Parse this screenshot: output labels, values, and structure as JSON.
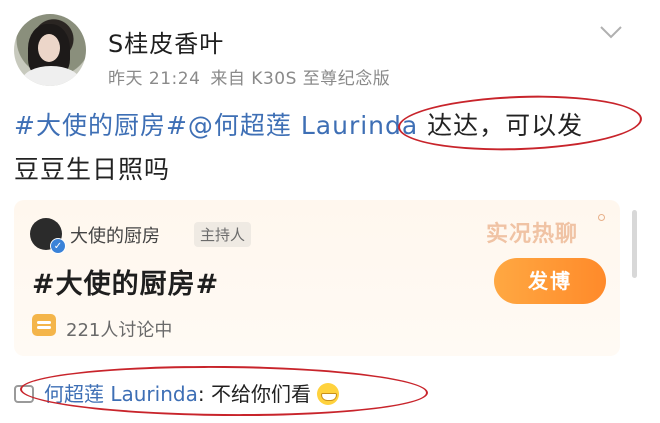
{
  "post": {
    "username": "S桂皮香叶",
    "time": "昨天 21:24",
    "source": "来自 K30S 至尊纪念版",
    "topic1": "#大使的厨房#",
    "mention": "@何超莲 Laurinda",
    "text_part1": " 达达，可以发",
    "text_part2": "豆豆生日照吗"
  },
  "card": {
    "source_name": "大使的厨房",
    "host_label": "主持人",
    "title": "#大使的厨房#",
    "discussion": "221人讨论中",
    "badge": "实况热聊",
    "post_button": "发博"
  },
  "comment": {
    "author": "何超莲 Laurinda",
    "text": ": 不给你们看"
  },
  "colors": {
    "link": "#3e6fb5",
    "accent": "#ff8a2a",
    "highlight": "#c8242b"
  }
}
